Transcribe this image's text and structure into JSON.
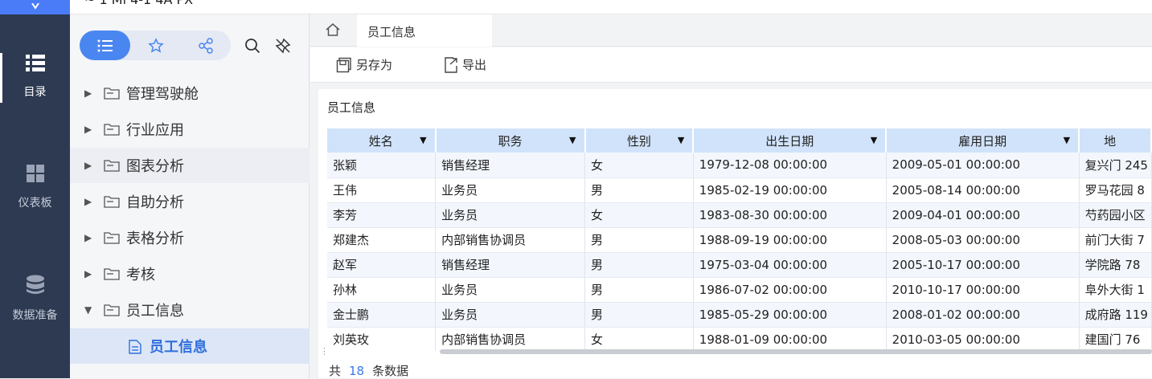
{
  "topbar": {
    "title": "~ 1 Mi 4-1 4A PX"
  },
  "rail": {
    "items": [
      {
        "label": "目录",
        "icon": "list-icon",
        "active": true
      },
      {
        "label": "仪表板",
        "icon": "dashboard-icon",
        "active": false
      },
      {
        "label": "数据准备",
        "icon": "database-icon",
        "active": false
      }
    ]
  },
  "tree": {
    "tabs": [
      "list-icon",
      "star-icon",
      "share-icon"
    ],
    "tools": [
      "search-icon",
      "unpin-icon"
    ],
    "nodes": [
      {
        "label": "管理驾驶舱",
        "expanded": false
      },
      {
        "label": "行业应用",
        "expanded": false
      },
      {
        "label": "图表分析",
        "expanded": false
      },
      {
        "label": "自助分析",
        "expanded": false
      },
      {
        "label": "表格分析",
        "expanded": false
      },
      {
        "label": "考核",
        "expanded": false
      },
      {
        "label": "员工信息",
        "expanded": true
      }
    ],
    "selected_leaf": "员工信息"
  },
  "tabs": {
    "active": "员工信息"
  },
  "toolbar": {
    "save_as": "另存为",
    "export": "导出"
  },
  "report": {
    "title": "员工信息",
    "columns": [
      "姓名",
      "职务",
      "性别",
      "出生日期",
      "雇用日期",
      "地"
    ],
    "rows": [
      [
        "张颖",
        "销售经理",
        "女",
        "1979-12-08 00:00:00",
        "2009-05-01 00:00:00",
        "复兴门 245"
      ],
      [
        "王伟",
        "业务员",
        "男",
        "1985-02-19 00:00:00",
        "2005-08-14 00:00:00",
        "罗马花园 8"
      ],
      [
        "李芳",
        "业务员",
        "女",
        "1983-08-30 00:00:00",
        "2009-04-01 00:00:00",
        "芍药园小区"
      ],
      [
        "郑建杰",
        "内部销售协调员",
        "男",
        "1988-09-19 00:00:00",
        "2008-05-03 00:00:00",
        "前门大街 7"
      ],
      [
        "赵军",
        "销售经理",
        "男",
        "1975-03-04 00:00:00",
        "2005-10-17 00:00:00",
        "学院路 78"
      ],
      [
        "孙林",
        "业务员",
        "男",
        "1986-07-02 00:00:00",
        "2010-10-17 00:00:00",
        "阜外大街 1"
      ],
      [
        "金士鹏",
        "业务员",
        "男",
        "1985-05-29 00:00:00",
        "2008-01-02 00:00:00",
        "成府路 119"
      ],
      [
        "刘英玫",
        "内部销售协调员",
        "女",
        "1988-01-09 00:00:00",
        "2010-03-05 00:00:00",
        "建国门 76"
      ]
    ],
    "footer": {
      "prefix": "共",
      "count": "18",
      "suffix": "条数据"
    }
  }
}
